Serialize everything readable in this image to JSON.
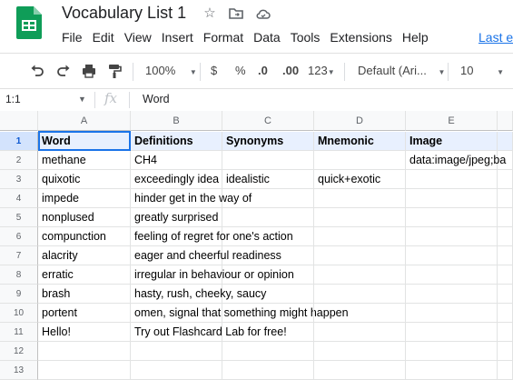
{
  "app": {
    "title": "Vocabulary List 1",
    "last_edit_label": "Last e"
  },
  "menu": [
    "File",
    "Edit",
    "View",
    "Insert",
    "Format",
    "Data",
    "Tools",
    "Extensions",
    "Help"
  ],
  "toolbar": {
    "zoom": "100%",
    "currency": "$",
    "percent": "%",
    "decrease_decimal": ".0",
    "increase_decimal": ".00",
    "more_formats": "123",
    "font": "Default (Ari...",
    "font_size": "10"
  },
  "formula_bar": {
    "cell_ref": "1:1",
    "fx": "fx",
    "value": "Word"
  },
  "grid": {
    "columns": [
      "A",
      "B",
      "C",
      "D",
      "E"
    ],
    "row_numbers": [
      "1",
      "2",
      "3",
      "4",
      "5",
      "6",
      "7",
      "8",
      "9",
      "10",
      "11",
      "12",
      "13"
    ],
    "header_row": [
      "Word",
      "Definitions",
      "Synonyms",
      "Mnemonic",
      "Image"
    ],
    "rows": [
      [
        "methane",
        "CH4",
        "",
        "",
        "data:image/jpeg;ba"
      ],
      [
        "quixotic",
        "exceedingly idea",
        "idealistic",
        "quick+exotic",
        ""
      ],
      [
        "impede",
        "hinder get in the way of",
        "",
        "",
        ""
      ],
      [
        "nonplused",
        "greatly surprised",
        "",
        "",
        ""
      ],
      [
        "compunction",
        "feeling of regret for one's action",
        "",
        "",
        ""
      ],
      [
        "alacrity",
        "eager and cheerful readiness",
        "",
        "",
        ""
      ],
      [
        "erratic",
        "irregular in behaviour or opinion",
        "",
        "",
        ""
      ],
      [
        "brash",
        "hasty, rush, cheeky, saucy",
        "",
        "",
        ""
      ],
      [
        "portent",
        "omen, signal that something might happen",
        "",
        "",
        ""
      ],
      [
        "Hello!",
        "Try out Flashcard Lab for free!",
        "",
        "",
        ""
      ],
      [
        "",
        "",
        "",
        "",
        ""
      ],
      [
        "",
        "",
        "",
        "",
        ""
      ]
    ]
  },
  "colors": {
    "sheets_green": "#0f9d58",
    "selection": "#1a73e8",
    "header_highlight": "#e8f0fe"
  }
}
